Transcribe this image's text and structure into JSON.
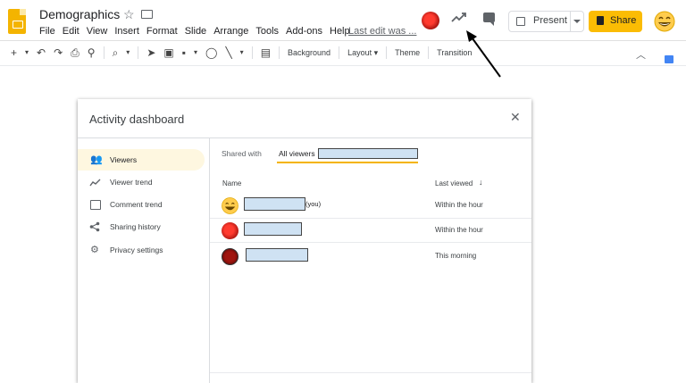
{
  "header": {
    "title": "Demographics",
    "menu": [
      "File",
      "Edit",
      "View",
      "Insert",
      "Format",
      "Slide",
      "Arrange",
      "Tools",
      "Add-ons",
      "Help"
    ],
    "last_edit": "Last edit was ...",
    "present_label": "Present",
    "share_label": "Share",
    "icons": [
      "slides-logo-icon",
      "star-icon",
      "folder-icon",
      "activity-trend-icon",
      "comment-icon",
      "present-icon",
      "share-lock-icon"
    ]
  },
  "toolbar": {
    "background": "Background",
    "layout": "Layout",
    "theme": "Theme",
    "transition": "Transition"
  },
  "dialog": {
    "title": "Activity dashboard",
    "nav": [
      {
        "label": "Viewers",
        "icon": "people-icon",
        "active": true
      },
      {
        "label": "Viewer trend",
        "icon": "trend-icon",
        "active": false
      },
      {
        "label": "Comment trend",
        "icon": "comment-trend-icon",
        "active": false
      },
      {
        "label": "Sharing history",
        "icon": "share-icon",
        "active": false
      },
      {
        "label": "Privacy settings",
        "icon": "gear-icon",
        "active": false
      }
    ],
    "tabs": {
      "shared_with": "Shared with",
      "all_viewers": "All viewers"
    },
    "columns": {
      "name": "Name",
      "last_viewed": "Last viewed"
    },
    "rows": [
      {
        "suffix": "(you)",
        "last_viewed": "Within the hour",
        "avatar": "emoji"
      },
      {
        "suffix": "",
        "last_viewed": "Within the hour",
        "avatar": "red"
      },
      {
        "suffix": "",
        "last_viewed": "This morning",
        "avatar": "dark-red"
      }
    ]
  },
  "colors": {
    "share_button": "#fbbc04",
    "active_nav": "#fef7e0",
    "tab_underline": "#f4b400",
    "redaction": "#cfe2f3"
  }
}
